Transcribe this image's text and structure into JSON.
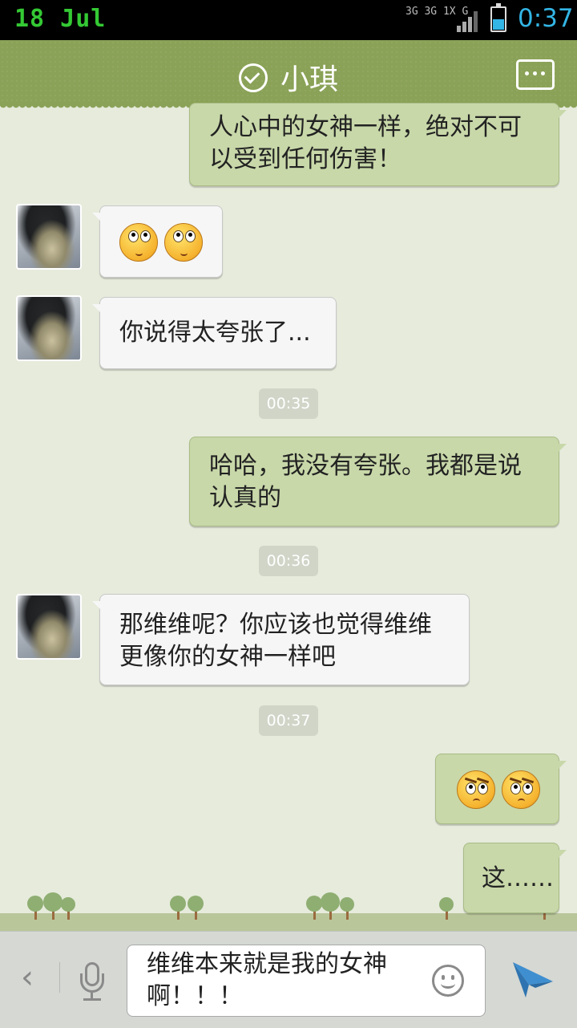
{
  "status_bar": {
    "date": "18 Jul",
    "network_top": "3G 3G 1X G",
    "time": "0:37"
  },
  "header": {
    "contact_name": "小琪",
    "verified_icon": "check-circle-icon",
    "menu_icon": "more-dots-icon"
  },
  "messages": [
    {
      "side": "right",
      "text": "人心中的女神一样，绝对不可以受到任何伤害！"
    },
    {
      "side": "left",
      "emoji": [
        "rolling-eyes-emoji",
        "rolling-eyes-emoji"
      ]
    },
    {
      "side": "left",
      "text": "你说得太夸张了..."
    },
    {
      "timestamp": "00:35"
    },
    {
      "side": "right",
      "text": "哈哈，我没有夸张。我都是说认真的"
    },
    {
      "timestamp": "00:36"
    },
    {
      "side": "left",
      "text": "那维维呢？你应该也觉得维维更像你的女神一样吧"
    },
    {
      "timestamp": "00:37"
    },
    {
      "side": "right",
      "emoji": [
        "angry-emoji",
        "angry-emoji"
      ]
    },
    {
      "side": "right",
      "text": "这……"
    }
  ],
  "composer": {
    "draft": "维维本来就是我的女神啊！！！"
  },
  "colors": {
    "header": "#8aa257",
    "background": "#e6ebdc",
    "outgoing_bubble": "#c8d8a9",
    "incoming_bubble": "#f6f6f6",
    "clock": "#33b5e5"
  }
}
